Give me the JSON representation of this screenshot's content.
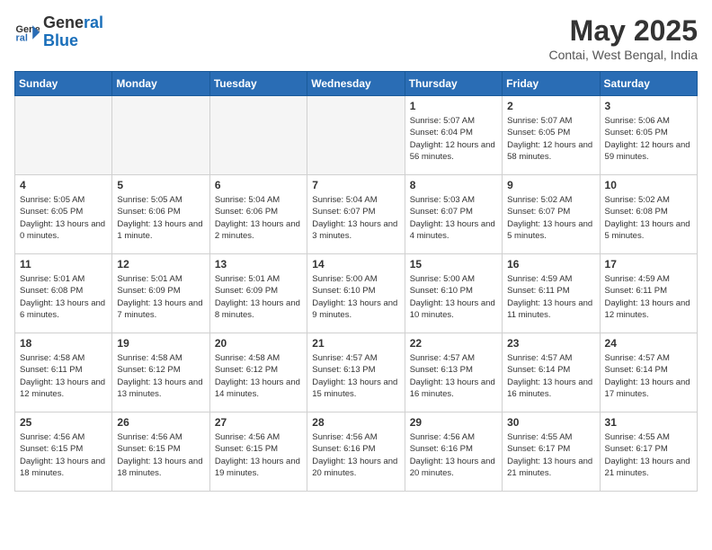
{
  "logo": {
    "line1": "General",
    "line2": "Blue"
  },
  "title": "May 2025",
  "location": "Contai, West Bengal, India",
  "days_of_week": [
    "Sunday",
    "Monday",
    "Tuesday",
    "Wednesday",
    "Thursday",
    "Friday",
    "Saturday"
  ],
  "weeks": [
    [
      {
        "day": "",
        "empty": true
      },
      {
        "day": "",
        "empty": true
      },
      {
        "day": "",
        "empty": true
      },
      {
        "day": "",
        "empty": true
      },
      {
        "day": "1",
        "sunrise": "5:07 AM",
        "sunset": "6:04 PM",
        "daylight": "12 hours and 56 minutes."
      },
      {
        "day": "2",
        "sunrise": "5:07 AM",
        "sunset": "6:05 PM",
        "daylight": "12 hours and 58 minutes."
      },
      {
        "day": "3",
        "sunrise": "5:06 AM",
        "sunset": "6:05 PM",
        "daylight": "12 hours and 59 minutes."
      }
    ],
    [
      {
        "day": "4",
        "sunrise": "5:05 AM",
        "sunset": "6:05 PM",
        "daylight": "13 hours and 0 minutes."
      },
      {
        "day": "5",
        "sunrise": "5:05 AM",
        "sunset": "6:06 PM",
        "daylight": "13 hours and 1 minute."
      },
      {
        "day": "6",
        "sunrise": "5:04 AM",
        "sunset": "6:06 PM",
        "daylight": "13 hours and 2 minutes."
      },
      {
        "day": "7",
        "sunrise": "5:04 AM",
        "sunset": "6:07 PM",
        "daylight": "13 hours and 3 minutes."
      },
      {
        "day": "8",
        "sunrise": "5:03 AM",
        "sunset": "6:07 PM",
        "daylight": "13 hours and 4 minutes."
      },
      {
        "day": "9",
        "sunrise": "5:02 AM",
        "sunset": "6:07 PM",
        "daylight": "13 hours and 5 minutes."
      },
      {
        "day": "10",
        "sunrise": "5:02 AM",
        "sunset": "6:08 PM",
        "daylight": "13 hours and 5 minutes."
      }
    ],
    [
      {
        "day": "11",
        "sunrise": "5:01 AM",
        "sunset": "6:08 PM",
        "daylight": "13 hours and 6 minutes."
      },
      {
        "day": "12",
        "sunrise": "5:01 AM",
        "sunset": "6:09 PM",
        "daylight": "13 hours and 7 minutes."
      },
      {
        "day": "13",
        "sunrise": "5:01 AM",
        "sunset": "6:09 PM",
        "daylight": "13 hours and 8 minutes."
      },
      {
        "day": "14",
        "sunrise": "5:00 AM",
        "sunset": "6:10 PM",
        "daylight": "13 hours and 9 minutes."
      },
      {
        "day": "15",
        "sunrise": "5:00 AM",
        "sunset": "6:10 PM",
        "daylight": "13 hours and 10 minutes."
      },
      {
        "day": "16",
        "sunrise": "4:59 AM",
        "sunset": "6:11 PM",
        "daylight": "13 hours and 11 minutes."
      },
      {
        "day": "17",
        "sunrise": "4:59 AM",
        "sunset": "6:11 PM",
        "daylight": "13 hours and 12 minutes."
      }
    ],
    [
      {
        "day": "18",
        "sunrise": "4:58 AM",
        "sunset": "6:11 PM",
        "daylight": "13 hours and 12 minutes."
      },
      {
        "day": "19",
        "sunrise": "4:58 AM",
        "sunset": "6:12 PM",
        "daylight": "13 hours and 13 minutes."
      },
      {
        "day": "20",
        "sunrise": "4:58 AM",
        "sunset": "6:12 PM",
        "daylight": "13 hours and 14 minutes."
      },
      {
        "day": "21",
        "sunrise": "4:57 AM",
        "sunset": "6:13 PM",
        "daylight": "13 hours and 15 minutes."
      },
      {
        "day": "22",
        "sunrise": "4:57 AM",
        "sunset": "6:13 PM",
        "daylight": "13 hours and 16 minutes."
      },
      {
        "day": "23",
        "sunrise": "4:57 AM",
        "sunset": "6:14 PM",
        "daylight": "13 hours and 16 minutes."
      },
      {
        "day": "24",
        "sunrise": "4:57 AM",
        "sunset": "6:14 PM",
        "daylight": "13 hours and 17 minutes."
      }
    ],
    [
      {
        "day": "25",
        "sunrise": "4:56 AM",
        "sunset": "6:15 PM",
        "daylight": "13 hours and 18 minutes."
      },
      {
        "day": "26",
        "sunrise": "4:56 AM",
        "sunset": "6:15 PM",
        "daylight": "13 hours and 18 minutes."
      },
      {
        "day": "27",
        "sunrise": "4:56 AM",
        "sunset": "6:15 PM",
        "daylight": "13 hours and 19 minutes."
      },
      {
        "day": "28",
        "sunrise": "4:56 AM",
        "sunset": "6:16 PM",
        "daylight": "13 hours and 20 minutes."
      },
      {
        "day": "29",
        "sunrise": "4:56 AM",
        "sunset": "6:16 PM",
        "daylight": "13 hours and 20 minutes."
      },
      {
        "day": "30",
        "sunrise": "4:55 AM",
        "sunset": "6:17 PM",
        "daylight": "13 hours and 21 minutes."
      },
      {
        "day": "31",
        "sunrise": "4:55 AM",
        "sunset": "6:17 PM",
        "daylight": "13 hours and 21 minutes."
      }
    ]
  ]
}
